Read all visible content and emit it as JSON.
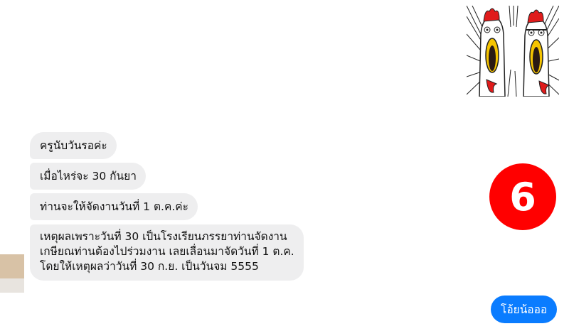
{
  "incoming_messages": [
    {
      "text": "ครูนับวันรอค่ะ"
    },
    {
      "text": "เมื่อไหร่จะ 30 กันยา"
    },
    {
      "text": "ท่านจะให้จัดงานวันที่ 1 ต.ค.ค่ะ"
    },
    {
      "text": "เหตุผลเพราะวันที่  30 เป็นโรงเรียนภรรยาท่านจัดงาน\nเกษียณท่านต้องไปร่วมงาน เลยเลื่อนมาจัดวันที่ 1 ต.ค.\nโดยให้เหตุผลว่าวันที่ 30 ก.ย. เป็นวันจม 5555"
    }
  ],
  "outgoing_message": {
    "text": "โอ้ยน้อออ"
  },
  "badge": {
    "number": "6",
    "color": "#ff0000"
  },
  "sticker": {
    "icon": "screaming-chickens-sticker-icon"
  },
  "colors": {
    "incoming_bubble": "#eeeeef",
    "outgoing_bubble": "#0a7cff",
    "badge": "#ff0000"
  }
}
